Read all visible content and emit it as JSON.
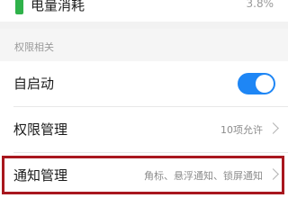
{
  "battery_row": {
    "label": "电量消耗",
    "value": "3.8%",
    "icon": "battery-icon",
    "icon_color": "#2fb24a"
  },
  "permissions_section": {
    "header": "权限相关"
  },
  "autostart_row": {
    "label": "自启动",
    "toggle_on": true,
    "toggle_color": "#1e86f5"
  },
  "permission_manage_row": {
    "label": "权限管理",
    "value": "10项允许"
  },
  "notification_manage_row": {
    "label": "通知管理",
    "value": "角标、悬浮通知、锁屏通知",
    "highlight_color": "#a8171e"
  }
}
